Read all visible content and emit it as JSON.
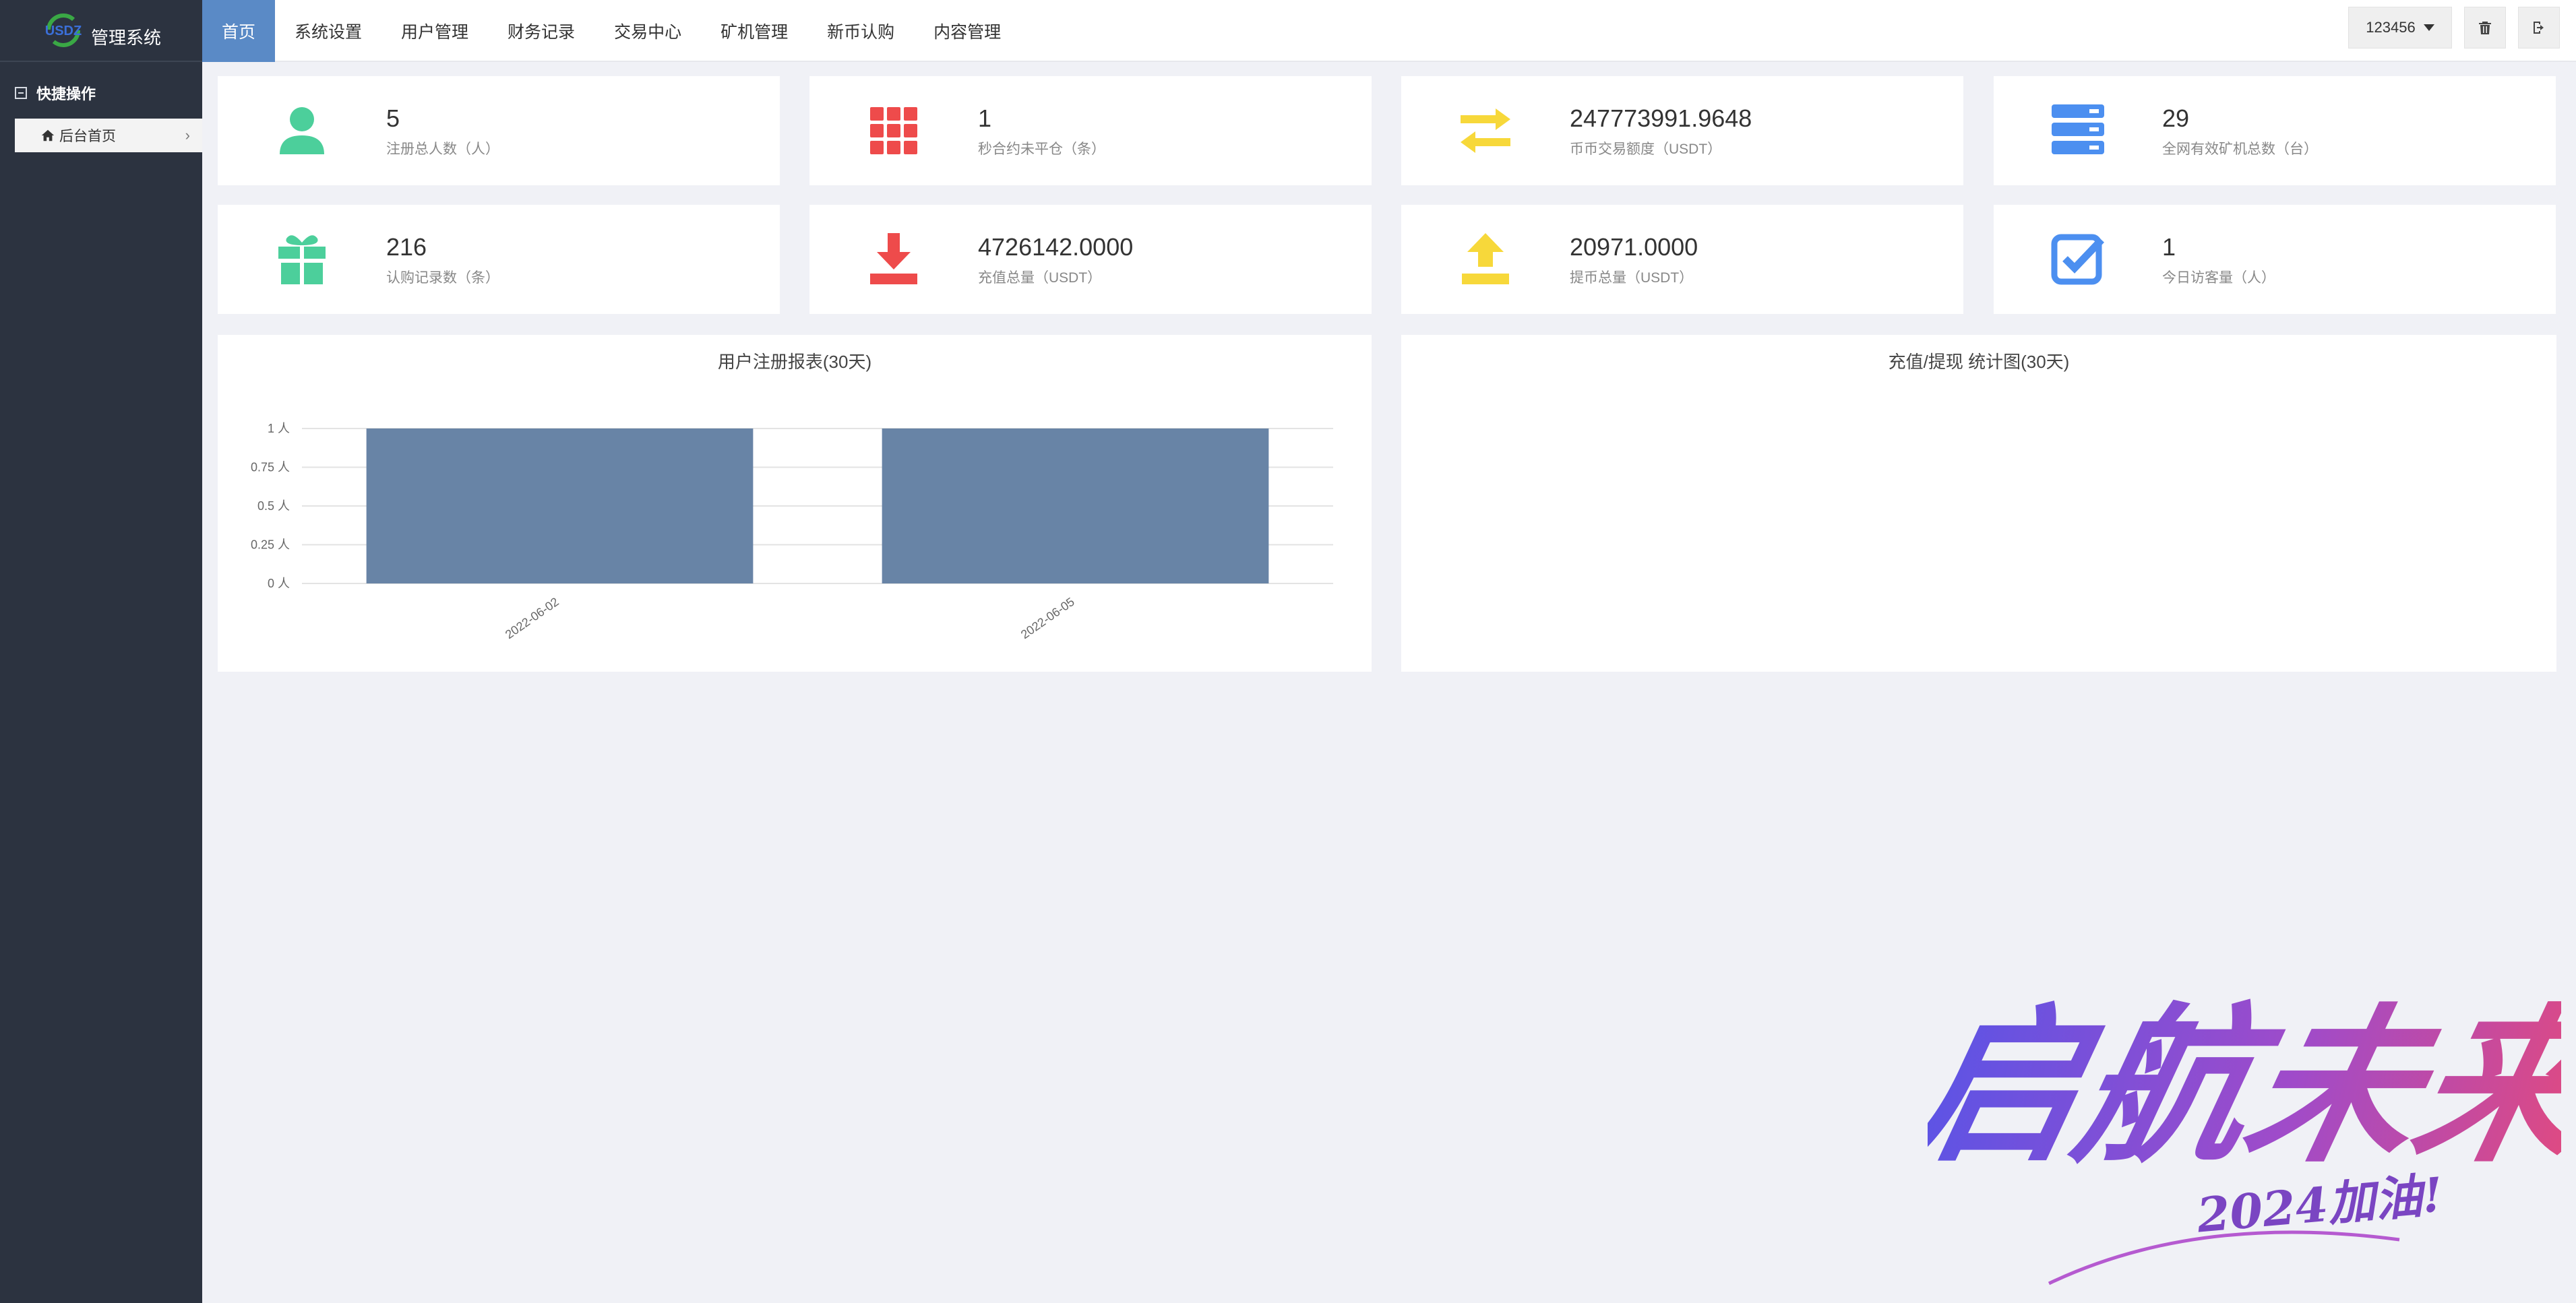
{
  "app": {
    "logo_text": "管理系统",
    "logo_mark_text": "USDZ"
  },
  "sidebar": {
    "section_title": "快捷操作",
    "items": [
      {
        "label": "后台首页"
      }
    ]
  },
  "nav": {
    "items": [
      {
        "label": "首页",
        "active": true
      },
      {
        "label": "系统设置"
      },
      {
        "label": "用户管理"
      },
      {
        "label": "财务记录"
      },
      {
        "label": "交易中心"
      },
      {
        "label": "矿机管理"
      },
      {
        "label": "新币认购"
      },
      {
        "label": "内容管理"
      }
    ]
  },
  "topbar": {
    "user": "123456",
    "delete_icon": "trash-icon",
    "logout_icon": "logout-icon"
  },
  "stats": [
    {
      "value": "5",
      "label": "注册总人数（人）",
      "icon": "user-icon",
      "color": "#4ccf9b"
    },
    {
      "value": "1",
      "label": "秒合约未平仓（条）",
      "icon": "grid-icon",
      "color": "#ee4b4b"
    },
    {
      "value": "247773991.9648",
      "label": "币币交易额度（USDT）",
      "icon": "exchange-icon",
      "color": "#f7d83a"
    },
    {
      "value": "29",
      "label": "全网有效矿机总数（台）",
      "icon": "server-icon",
      "color": "#4c8ff0"
    },
    {
      "value": "216",
      "label": "认购记录数（条）",
      "icon": "gift-icon",
      "color": "#4ccf9b"
    },
    {
      "value": "4726142.0000",
      "label": "充值总量（USDT）",
      "icon": "download-icon",
      "color": "#ee4b4b"
    },
    {
      "value": "20971.0000",
      "label": "提币总量（USDT）",
      "icon": "upload-icon",
      "color": "#f7d83a"
    },
    {
      "value": "1",
      "label": "今日访客量（人）",
      "icon": "checkbox-icon",
      "color": "#4c8ff0"
    }
  ],
  "panels": {
    "left_title": "用户注册报表(30天)",
    "right_title": "充值/提现 统计图(30天)"
  },
  "chart_data": {
    "type": "bar",
    "title": "用户注册报表(30天)",
    "categories": [
      "2022-06-02",
      "2022-06-05"
    ],
    "values": [
      1,
      1
    ],
    "ylim": [
      0,
      1
    ],
    "yticks": [
      "0 人",
      "0.25 人",
      "0.5 人",
      "0.75 人",
      "1 人"
    ],
    "ytick_values": [
      0,
      0.25,
      0.5,
      0.75,
      1
    ],
    "bar_color": "#6884a6",
    "grid": true
  },
  "watermark": {
    "main": "启航未来",
    "sub": "2024加油!"
  }
}
